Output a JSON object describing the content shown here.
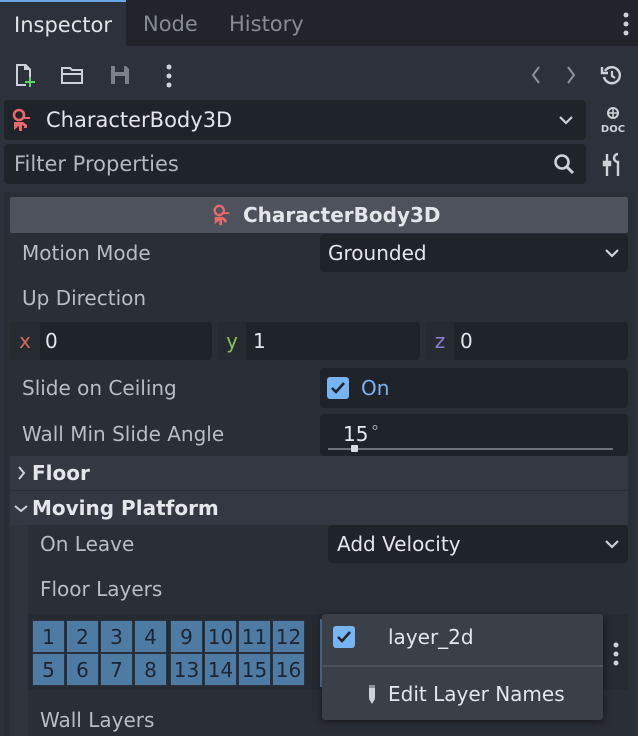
{
  "tabs": [
    "Inspector",
    "Node",
    "History"
  ],
  "node_selector": {
    "name": "CharacterBody3D"
  },
  "filter": {
    "placeholder": "Filter Properties"
  },
  "section_title": "CharacterBody3D",
  "properties": {
    "motion_mode": {
      "label": "Motion Mode",
      "value": "Grounded"
    },
    "up_direction": {
      "label": "Up Direction",
      "x_label": "x",
      "x": "0",
      "y_label": "y",
      "y": "1",
      "z_label": "z",
      "z": "0"
    },
    "slide_on_ceiling": {
      "label": "Slide on Ceiling",
      "value": "On",
      "checked": true
    },
    "wall_min_slide_angle": {
      "label": "Wall Min Slide Angle",
      "value": "15",
      "unit": "°",
      "fraction": 0.09
    }
  },
  "groups": {
    "floor": "Floor",
    "moving_platform": "Moving Platform"
  },
  "moving_platform": {
    "on_leave": {
      "label": "On Leave",
      "value": "Add Velocity"
    },
    "floor_layers": {
      "label": "Floor Layers",
      "row1": [
        "1",
        "2",
        "3",
        "4",
        "9",
        "10",
        "11",
        "12"
      ],
      "row2": [
        "5",
        "6",
        "7",
        "8",
        "13",
        "14",
        "15",
        "16"
      ]
    },
    "wall_layers": {
      "label": "Wall Layers"
    }
  },
  "popup": {
    "item_layer": "layer_2d",
    "item_edit": "Edit Layer Names"
  },
  "colors": {
    "accent": "#6ba5e3",
    "node_icon": "#e8696a",
    "layer_cell": "#4e7ba4",
    "check": "#78b4f0"
  }
}
